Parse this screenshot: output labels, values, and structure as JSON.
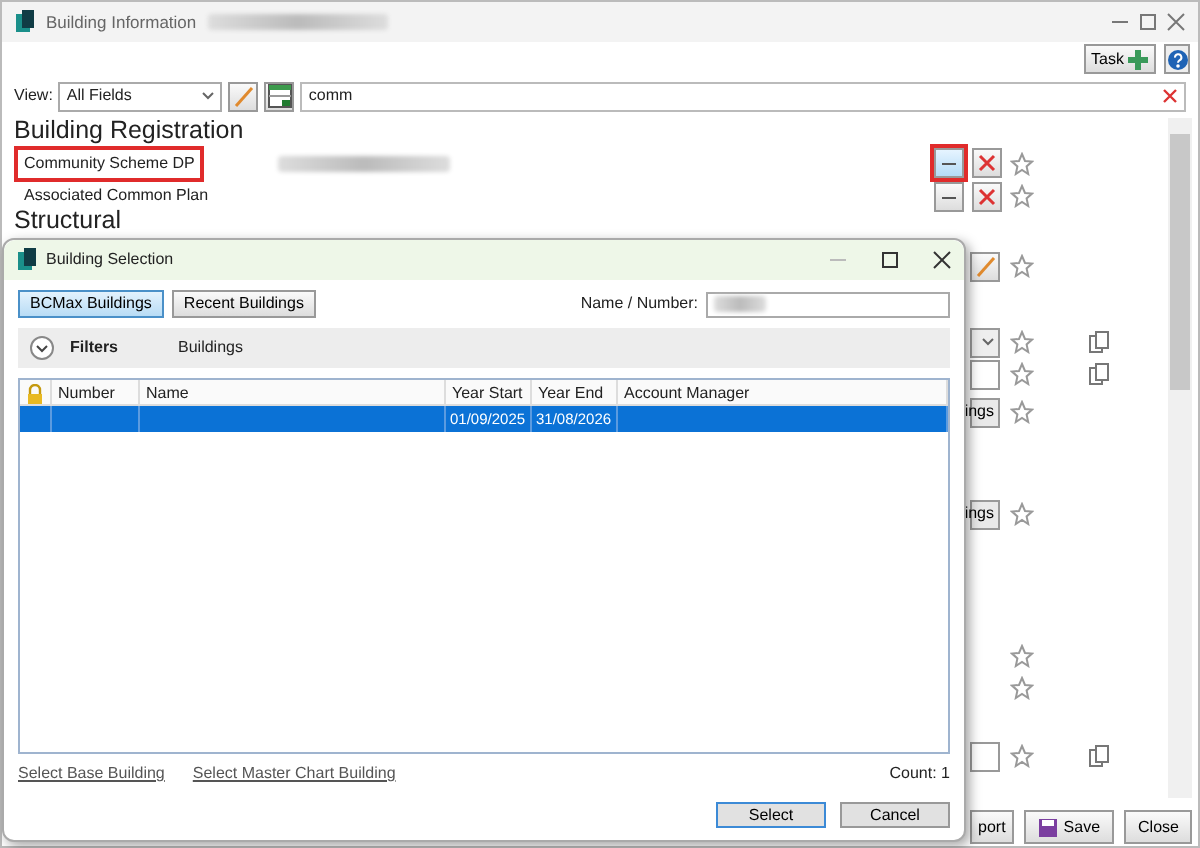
{
  "window": {
    "title": "Building Information"
  },
  "toolbar": {
    "task_button": "Task"
  },
  "view": {
    "label": "View:",
    "value": "All Fields",
    "search": "comm"
  },
  "section_heading": "Building Registration",
  "fields": [
    {
      "label": "Community Scheme DP",
      "highlighted": true
    },
    {
      "label": "Associated Common Plan",
      "highlighted": false
    }
  ],
  "next_heading": "Structural",
  "side_controls": [
    {
      "kind": "pencil"
    },
    {
      "kind": "dropdown",
      "copy": true
    },
    {
      "kind": "field",
      "copy": true
    },
    {
      "kind": "button",
      "label": "ings"
    },
    {
      "kind": "button",
      "label": "ings"
    },
    {
      "kind": "star"
    },
    {
      "kind": "star"
    },
    {
      "kind": "field",
      "copy": true
    }
  ],
  "footer_buttons": [
    {
      "label": "port",
      "kind": "plain"
    },
    {
      "label": "Save",
      "kind": "save"
    },
    {
      "label": "Close",
      "kind": "plain"
    }
  ],
  "dialog": {
    "title": "Building Selection",
    "tabs": [
      {
        "label": "BCMax Buildings",
        "selected": true
      },
      {
        "label": "Recent Buildings",
        "selected": false
      }
    ],
    "name_label": "Name / Number:",
    "filters": {
      "label": "Filters",
      "scope": "Buildings",
      "expanded": false
    },
    "table": {
      "columns": [
        "Number",
        "Name",
        "Year Start",
        "Year End",
        "Account Manager"
      ],
      "rows": [
        {
          "year_start": "01/09/2025",
          "year_end": "31/08/2026",
          "selected": true
        }
      ]
    },
    "links": [
      "Select Base Building",
      "Select Master Chart Building"
    ],
    "count": "Count: 1",
    "buttons": [
      "Select",
      "Cancel"
    ]
  }
}
